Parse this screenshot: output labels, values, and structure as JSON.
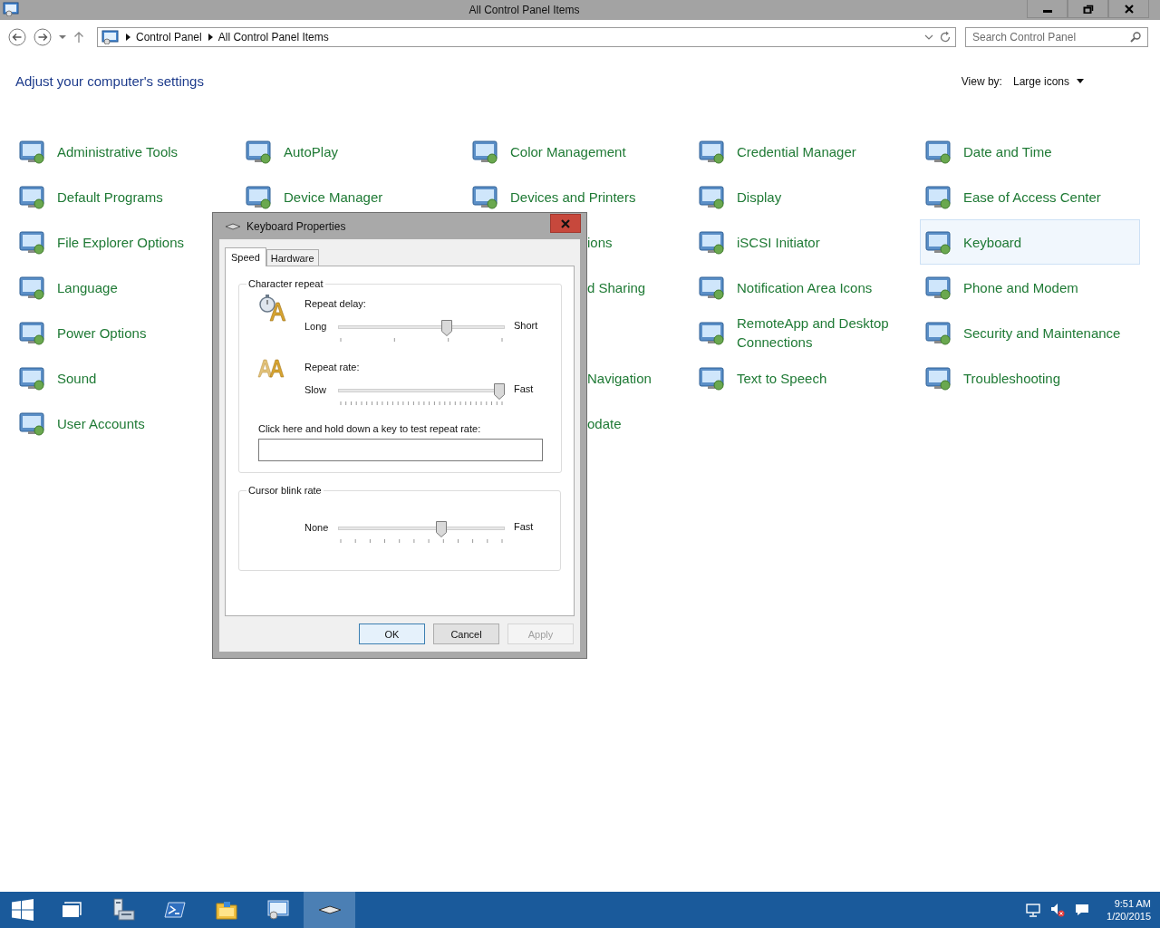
{
  "window": {
    "title": "All Control Panel Items"
  },
  "navigation": {
    "breadcrumbs": [
      "Control Panel",
      "All Control Panel Items"
    ],
    "search": {
      "placeholder": "Search Control Panel"
    }
  },
  "header": {
    "title": "Adjust your computer's settings",
    "view_by_label": "View by:",
    "view_by_value": "Large icons"
  },
  "columns": [
    {
      "items": [
        {
          "kind": "full",
          "label": "Administrative Tools",
          "selected": false
        },
        {
          "kind": "full",
          "label": "Default Programs",
          "selected": false
        },
        {
          "kind": "full",
          "label": "File Explorer Options",
          "selected": false
        },
        {
          "kind": "full",
          "label": "Language",
          "selected": false
        },
        {
          "kind": "full",
          "label": "Power Options",
          "selected": false
        },
        {
          "kind": "full",
          "label": "Sound",
          "selected": false
        },
        {
          "kind": "full",
          "label": "User Accounts",
          "selected": false
        }
      ]
    },
    {
      "items": [
        {
          "kind": "full",
          "label": "AutoPlay",
          "selected": false
        },
        {
          "kind": "full",
          "label": "Device Manager",
          "selected": false
        }
      ]
    },
    {
      "items": [
        {
          "kind": "full",
          "label": "Color Management",
          "selected": false
        },
        {
          "kind": "full",
          "label": "Devices and Printers",
          "selected": false
        },
        {
          "kind": "partial",
          "label": "ions",
          "selected": false
        },
        {
          "kind": "partial",
          "label": "d Sharing",
          "selected": false
        },
        {
          "kind": "covered"
        },
        {
          "kind": "partial",
          "label": "Navigation",
          "selected": false
        },
        {
          "kind": "partial",
          "label": "odate",
          "selected": false
        }
      ]
    },
    {
      "items": [
        {
          "kind": "full",
          "label": "Credential Manager",
          "selected": false
        },
        {
          "kind": "full",
          "label": "Display",
          "selected": false
        },
        {
          "kind": "full",
          "label": "iSCSI Initiator",
          "selected": false
        },
        {
          "kind": "full",
          "label": "Notification Area Icons",
          "selected": false
        },
        {
          "kind": "full",
          "label": "RemoteApp and Desktop Connections",
          "selected": false
        },
        {
          "kind": "full",
          "label": "Text to Speech",
          "selected": false
        }
      ]
    },
    {
      "items": [
        {
          "kind": "full",
          "label": "Date and Time",
          "selected": false
        },
        {
          "kind": "full",
          "label": "Ease of Access Center",
          "selected": false
        },
        {
          "kind": "full",
          "label": "Keyboard",
          "selected": true
        },
        {
          "kind": "full",
          "label": "Phone and Modem",
          "selected": false
        },
        {
          "kind": "full",
          "label": "Security and Maintenance",
          "selected": false
        },
        {
          "kind": "full",
          "label": "Troubleshooting",
          "selected": false
        }
      ]
    }
  ],
  "dialog": {
    "title": "Keyboard Properties",
    "tabs": [
      {
        "label": "Speed",
        "selected": true
      },
      {
        "label": "Hardware",
        "selected": false
      }
    ],
    "groups": [
      {
        "title": "Character repeat",
        "sliders": [
          {
            "kind": "delay",
            "label": "Repeat delay:",
            "min_label": "Long",
            "max_label": "Short",
            "level": 0.66
          },
          {
            "kind": "rate",
            "label": "Repeat rate:",
            "min_label": "Slow",
            "max_label": "Fast",
            "level": 1.0
          }
        ],
        "test_field": {
          "label": "Click here and hold down a key to test repeat rate:"
        }
      },
      {
        "title": "Cursor blink rate",
        "sliders": [
          {
            "kind": "blink",
            "min_label": "None",
            "max_label": "Fast",
            "level": 0.63
          }
        ]
      }
    ],
    "buttons": [
      {
        "label": "OK",
        "default": true,
        "disabled": false
      },
      {
        "label": "Cancel",
        "default": false,
        "disabled": false
      },
      {
        "label": "Apply",
        "default": false,
        "disabled": true
      }
    ]
  },
  "taskbar": {
    "apps": [
      {
        "kind": "start",
        "selected": false
      },
      {
        "kind": "task-view",
        "selected": false
      },
      {
        "kind": "server-manager",
        "selected": false
      },
      {
        "kind": "powershell",
        "selected": false
      },
      {
        "kind": "file-explorer",
        "selected": false
      },
      {
        "kind": "control-panel",
        "selected": false
      },
      {
        "kind": "keyboard",
        "selected": true
      }
    ],
    "clock": {
      "time": "9:51 AM",
      "date": "1/20/2015"
    }
  }
}
